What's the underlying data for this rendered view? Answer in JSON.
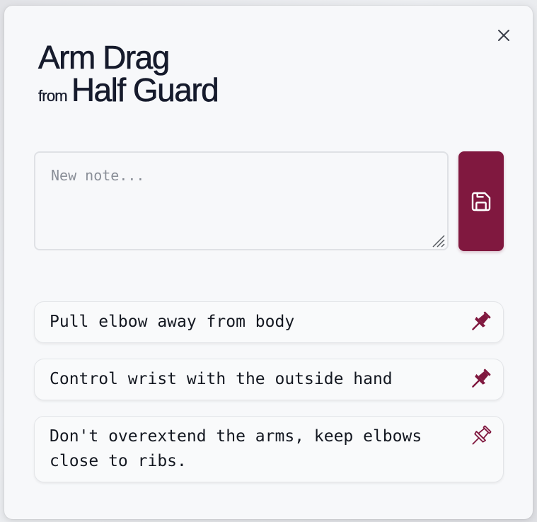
{
  "modal": {
    "title_main": "Arm Drag",
    "title_from": "from",
    "title_target": "Half Guard",
    "close_icon": "close-icon"
  },
  "note_form": {
    "placeholder": "New note...",
    "value": "",
    "save_icon": "save-icon"
  },
  "notes": [
    {
      "text": "Pull elbow away from body",
      "pinned": true
    },
    {
      "text": "Control wrist with the outside hand",
      "pinned": true
    },
    {
      "text": "Don't overextend the arms, keep elbows close to ribs.",
      "pinned": false
    }
  ],
  "colors": {
    "accent": "#80183f",
    "title": "#161b2c",
    "background": "#f7f8fa"
  }
}
